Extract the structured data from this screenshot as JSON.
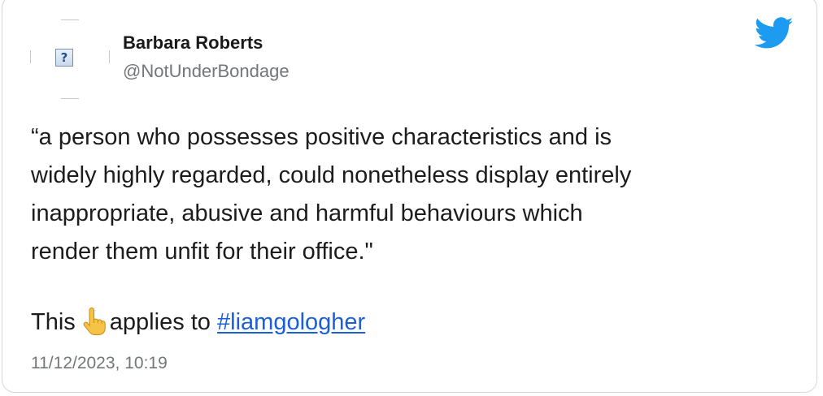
{
  "author": {
    "name": "Barbara Roberts",
    "handle": "@NotUnderBondage",
    "avatar_icon": "broken-image-icon",
    "avatar_placeholder": "?"
  },
  "logo": {
    "icon": "twitter-bird-icon",
    "color": "#1d9bf0"
  },
  "tweet": {
    "lines": [
      "“a person who possesses positive characteristics and is",
      "widely highly regarded, could nonetheless display entirely",
      "inappropriate, abusive and harmful behaviours which",
      "render them unfit for their office.\""
    ],
    "prefix": "This",
    "emoji_icon": "pointing-up-hand-icon",
    "suffix": "applies to",
    "hashtag": "#liamgologher",
    "hashtag_color": "#1a5fd6"
  },
  "timestamp": "11/12/2023, 10:19"
}
